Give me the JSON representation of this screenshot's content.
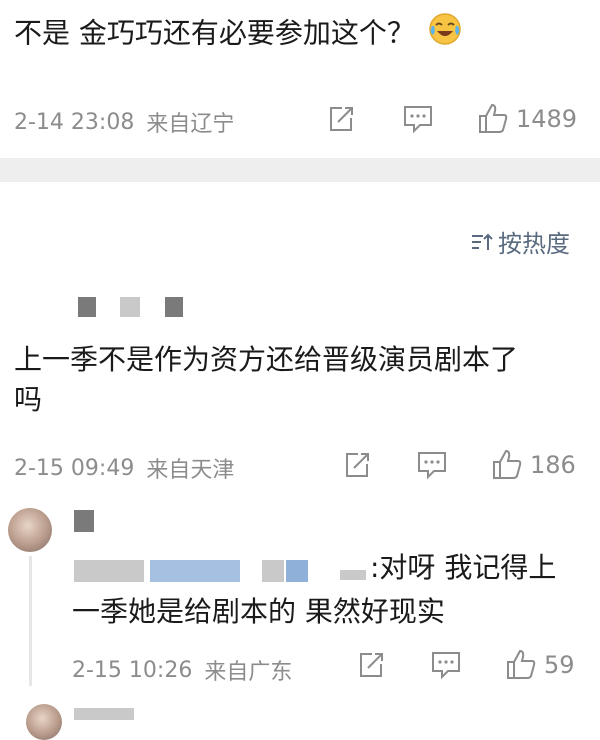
{
  "comments": [
    {
      "text": "不是 金巧巧还有必要参加这个？",
      "time": "2-14 23:08",
      "location": "来自辽宁",
      "likes": "1489",
      "emoji": "laughing-tears-emoji"
    },
    {
      "text_line1": "上一季不是作为资方还给晋级演员剧本了",
      "text_line2": "吗",
      "time": "2-15 09:49",
      "location": "来自天津",
      "likes": "186"
    }
  ],
  "sort": {
    "label": "按热度",
    "icon": "sort-icon"
  },
  "reply": {
    "text_suffix": ":对呀 我记得上",
    "text_line2": "一季她是给剧本的 果然好现实",
    "time": "2-15 10:26",
    "location": "来自广东",
    "likes": "59"
  },
  "colors": {
    "meta": "#8c8c8c",
    "divider": "#eeeeee",
    "sort": "#5a6b80"
  }
}
